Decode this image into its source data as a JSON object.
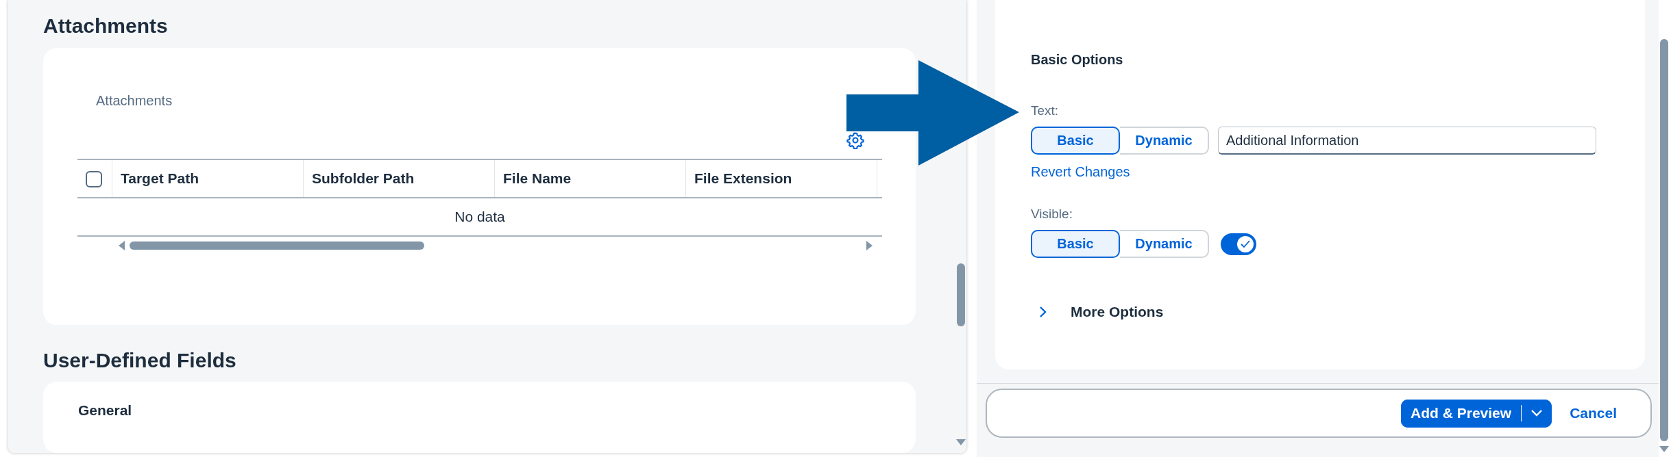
{
  "attachments_section": {
    "heading": "Attachments",
    "card_title": "Attachments",
    "table": {
      "select_all_checked": false,
      "columns": [
        {
          "label": "Target Path"
        },
        {
          "label": "Subfolder Path"
        },
        {
          "label": "File Name"
        },
        {
          "label": "File Extension"
        }
      ],
      "empty_text": "No data"
    }
  },
  "user_defined_section": {
    "heading": "User-Defined Fields",
    "group_title": "General"
  },
  "options_panel": {
    "title": "Basic Options",
    "properties": [
      {
        "kind": "text",
        "label": "Text:",
        "modes": [
          {
            "label": "Basic",
            "selected": true
          },
          {
            "label": "Dynamic",
            "selected": false
          }
        ],
        "value": "Additional Information",
        "link": "Revert Changes"
      },
      {
        "kind": "switch",
        "label": "Visible:",
        "modes": [
          {
            "label": "Basic",
            "selected": true
          },
          {
            "label": "Dynamic",
            "selected": false
          }
        ],
        "on": true
      }
    ],
    "more_options": {
      "label": "More Options",
      "expanded": false
    }
  },
  "footer": {
    "primary": "Add & Preview",
    "cancel": "Cancel"
  }
}
